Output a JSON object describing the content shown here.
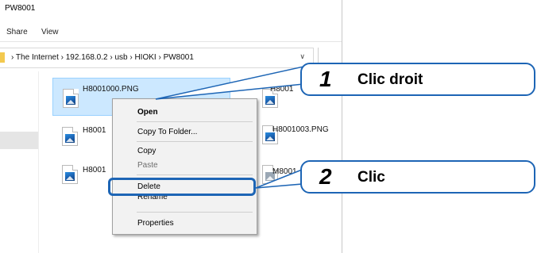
{
  "window": {
    "title": "PW8001",
    "ribbon": [
      "Share",
      "View"
    ],
    "address": {
      "crumbs": "› The Internet › 192.168.0.2 › usb › HIOKI › PW8001",
      "dropdown_glyph": "∨"
    }
  },
  "files": [
    {
      "name": "H8001000.PNG",
      "selected": true
    },
    {
      "name": "H8001",
      "selected": false
    },
    {
      "name": "H8001",
      "selected": false
    },
    {
      "name": "H8001",
      "selected": false
    },
    {
      "name": "H8001003.PNG",
      "selected": false
    },
    {
      "name": "M8001",
      "selected": false
    }
  ],
  "context_menu": {
    "items": [
      {
        "label": "Open"
      },
      {
        "label": "Copy To Folder..."
      },
      {
        "label": "Copy"
      },
      {
        "label": "Paste"
      },
      {
        "label": "Delete"
      },
      {
        "label": "Rename"
      },
      {
        "label": "Properties"
      }
    ]
  },
  "callouts": [
    {
      "step": "1",
      "text": "Clic droit"
    },
    {
      "step": "2",
      "text": "Clic"
    }
  ],
  "colors": {
    "accent": "#1d65b5",
    "selection": "#cce8ff",
    "menu_bg": "#f2f2f2"
  }
}
